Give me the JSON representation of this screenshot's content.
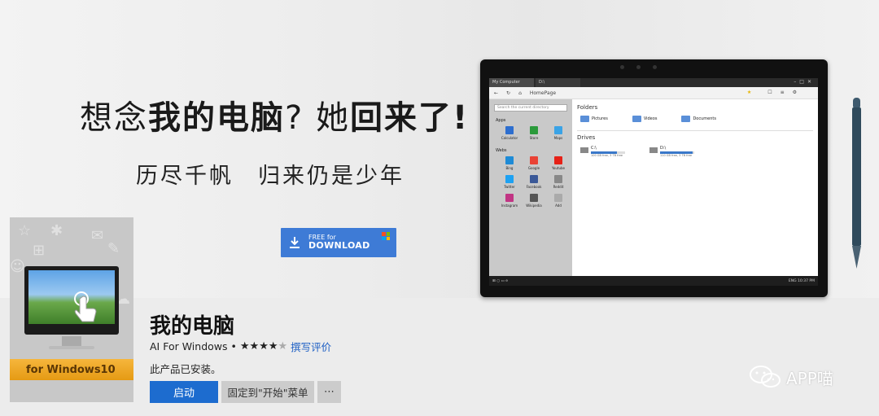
{
  "hero": {
    "title_a": "想念",
    "title_b": "我的电脑",
    "title_c": "? 她",
    "title_d": "回来了",
    "title_e": "!",
    "sub_1": "历尽千帆",
    "sub_2": "归来仍是少年"
  },
  "download": {
    "top": "FREE for",
    "bottom": "DOWNLOAD"
  },
  "tablet": {
    "tabs": [
      "My Computer",
      "D:\\"
    ],
    "nav_label": "HomePage",
    "search_placeholder": "Search the current directory",
    "apps_heading": "Apps",
    "apps": [
      {
        "label": "Calculator",
        "color": "#2d6ecf"
      },
      {
        "label": "Store",
        "color": "#2b9a3b"
      },
      {
        "label": "Maps",
        "color": "#3aa3e6"
      }
    ],
    "webs_heading": "Webs",
    "webs": [
      {
        "label": "Bing",
        "color": "#1e8bd6"
      },
      {
        "label": "Google",
        "color": "#e94235"
      },
      {
        "label": "Youtube",
        "color": "#e62117"
      },
      {
        "label": "Twitter",
        "color": "#1da1f2"
      },
      {
        "label": "Facebook",
        "color": "#3b5998"
      },
      {
        "label": "Reddit",
        "color": "#888888"
      },
      {
        "label": "Instagram",
        "color": "#c13584"
      },
      {
        "label": "Wikipedia",
        "color": "#555555"
      },
      {
        "label": "Add",
        "color": "#aaaaaa"
      }
    ],
    "folders_heading": "Folders",
    "folders": [
      "Pictures",
      "Videos",
      "Documents"
    ],
    "drives_heading": "Drives",
    "drives": [
      {
        "name": "C:\\",
        "used": 0.75,
        "info": "100 GB free, 3 TB free"
      },
      {
        "name": "D:\\",
        "used": 0.95,
        "info": "110 GB free, 3 TB free"
      }
    ],
    "taskbar_time": "ENG 10:37 PM"
  },
  "app": {
    "tile_banner": "for Windows10",
    "name": "我的电脑",
    "publisher": "AI For Windows",
    "rating": 4,
    "review_link": "撰写评价",
    "installed": "此产品已安装。",
    "launch": "启动",
    "pin": "固定到\"开始\"菜单",
    "more": "⋯"
  },
  "watermark": "APP喵"
}
